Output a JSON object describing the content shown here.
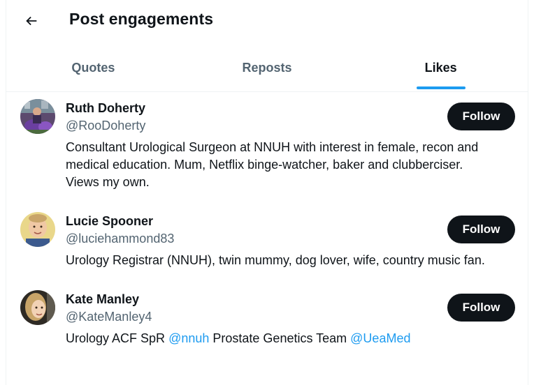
{
  "header": {
    "title": "Post engagements",
    "back_icon": "arrow-left-icon"
  },
  "tabs": [
    {
      "label": "Quotes",
      "active": false
    },
    {
      "label": "Reposts",
      "active": false
    },
    {
      "label": "Likes",
      "active": true
    }
  ],
  "users": [
    {
      "name": "Ruth Doherty",
      "handle": "@RooDoherty",
      "bio_line1": "Consultant Urological Surgeon at NNUH with interest in female, recon and",
      "bio_line2": "medical education. Mum, Netflix binge-watcher, baker and clubberciser.",
      "bio_line3": "Views my own.",
      "follow_label": "Follow"
    },
    {
      "name": "Lucie Spooner",
      "handle": "@luciehammond83",
      "bio_line1": "Urology Registrar (NNUH), twin mummy, dog lover, wife, country music fan.",
      "follow_label": "Follow"
    },
    {
      "name": "Kate Manley",
      "handle": "@KateManley4",
      "bio_text1": "Urology ACF SpR ",
      "bio_mention1": "@nnuh",
      "bio_text2": " Prostate Genetics Team ",
      "bio_mention2": "@UeaMed",
      "follow_label": "Follow"
    }
  ],
  "colors": {
    "accent": "#1d9bf0",
    "text_primary": "#0f1419",
    "text_secondary": "#536471",
    "button_bg": "#0f1419"
  }
}
